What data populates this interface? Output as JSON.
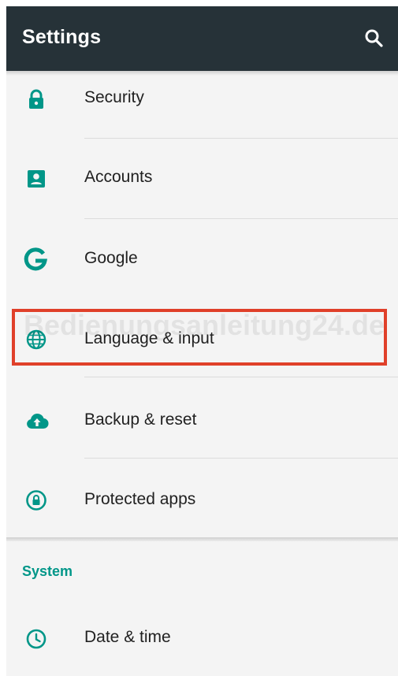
{
  "app": {
    "title": "Settings"
  },
  "toolbar": {
    "search_icon": "search-icon"
  },
  "settings_items": [
    {
      "label": "Security",
      "icon": "lock-icon"
    },
    {
      "label": "Accounts",
      "icon": "account-box-icon"
    },
    {
      "label": "Google",
      "icon": "google-g-icon"
    },
    {
      "label": "Language & input",
      "icon": "globe-icon"
    },
    {
      "label": "Backup & reset",
      "icon": "cloud-upload-icon"
    },
    {
      "label": "Protected apps",
      "icon": "protected-lock-icon"
    }
  ],
  "system_section": {
    "header": "System",
    "items": [
      {
        "label": "Date & time",
        "icon": "clock-icon"
      }
    ]
  },
  "annotation": {
    "highlighted_item": "Language & input",
    "highlight_color": "#e0402a"
  },
  "watermark": {
    "text": "Bedienungsanleitung24.de"
  },
  "colors": {
    "toolbar_bg": "#263238",
    "accent": "#009688",
    "background": "#f4f4f4",
    "text_primary": "#212121"
  }
}
